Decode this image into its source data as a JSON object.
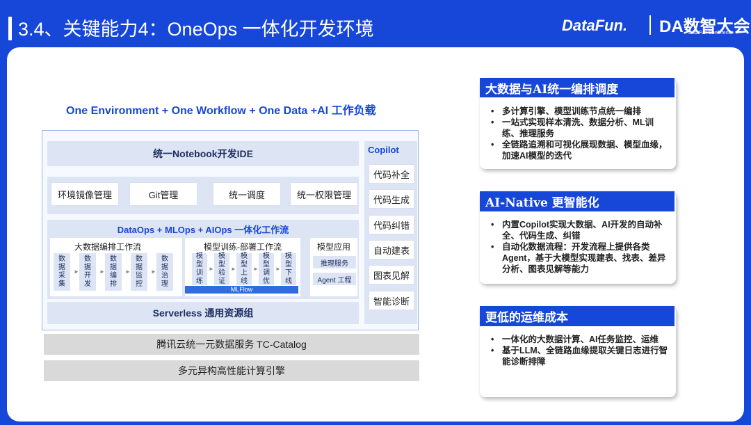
{
  "header": {
    "title": "3.4、关键能力4：OneOps 一体化开发环境",
    "logo_datafun": "DataFun.",
    "logo_da": "DA数智大会",
    "logo_da_sub": "DataFun Conference"
  },
  "diagram": {
    "subtitle": "One Environment + One Workflow + One Data +AI 工作负载",
    "notebook": "统一Notebook开发IDE",
    "tools": [
      "环境镜像管理",
      "Git管理",
      "统一调度",
      "统一权限管理"
    ],
    "workflow_title": "DataOps + MLOps + AIOps 一体化工作流",
    "bigdata_title": "大数据编排工作流",
    "bigdata_steps": [
      "数据采集",
      "数据开发",
      "数据编排",
      "数据监控",
      "数据治理"
    ],
    "model_title": "模型训练-部署工作流",
    "model_steps": [
      "模型训练",
      "模型验证",
      "模型上线",
      "模型调优",
      "模型下线"
    ],
    "mlflow": "MLFlow",
    "app_title": "模型应用",
    "app_items": [
      "推理服务",
      "Agent 工程"
    ],
    "serverless": "Serverless 通用资源组",
    "copilot_title": "Copilot",
    "copilot_items": [
      "代码补全",
      "代码生成",
      "代码纠错",
      "自动建表",
      "图表见解",
      "智能诊断"
    ],
    "catalog": "腾讯云统一元数据服务 TC-Catalog",
    "engine": "多元异构高性能计算引擎"
  },
  "cards": [
    {
      "title": "大数据与AI统一编排调度",
      "items": [
        "多计算引擎、模型训练节点统一编排",
        "一站式实现样本清洗、数据分析、ML训练、推理服务",
        "全链路追溯和可视化展现数据、模型血缘，加速AI模型的迭代"
      ]
    },
    {
      "title": "AI-Native 更智能化",
      "items": [
        "内置Copilot实现大数据、AI开发的自动补全、代码生成、纠错",
        "自动化数据流程：开发流程上提供各类 Agent，基于大模型实现建表、找表、差异分析、图表见解等能力"
      ]
    },
    {
      "title": "更低的运维成本",
      "items": [
        "一体化的大数据计算、AI任务监控、运维",
        "基于LLM、全链路血缘提取关键日志进行智能诊断排障"
      ]
    }
  ]
}
